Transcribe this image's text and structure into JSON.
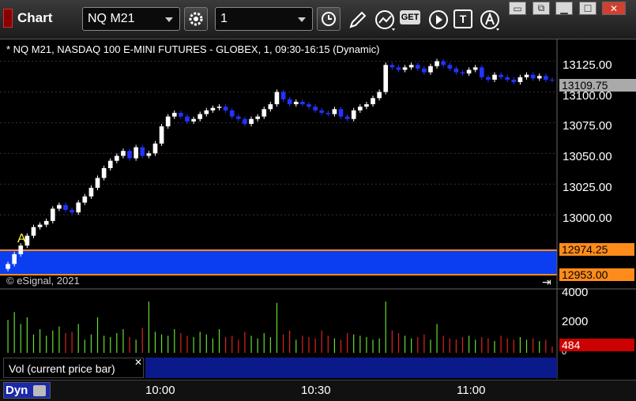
{
  "toolbar": {
    "app_title": "Chart",
    "symbol": "NQ M21",
    "interval": "1",
    "icons": [
      "settings-gear-icon",
      "clock-icon",
      "pencil-icon",
      "study-icon",
      "get-icon",
      "play-icon",
      "text-icon",
      "alert-icon"
    ],
    "get_label": "GET",
    "text_label": "T",
    "window_buttons": [
      "restore",
      "maximize",
      "minimize",
      "close"
    ]
  },
  "chart": {
    "header": "* NQ M21, NASDAQ 100 E-MINI FUTURES - GLOBEX, 1, 09:30-16:15 (Dynamic)",
    "copyright": "© eSignal, 2021",
    "marker_label": "A",
    "price_ticks": [
      "13125.00",
      "13100.00",
      "13075.00",
      "13050.00",
      "13025.00",
      "13000.00"
    ],
    "last_price": "13109.75",
    "range_high": "12974.25",
    "range_low": "12953.00",
    "volume_ticks": [
      "4000",
      "2000",
      "0"
    ],
    "last_volume": "484",
    "volume_label": "Vol (current price bar)",
    "time_ticks": [
      "10:00",
      "10:30",
      "11:00"
    ],
    "status_mode": "Dyn",
    "colors": {
      "up": "#ffffff",
      "down": "#2233ff",
      "band": "#0b3ef0",
      "band_border": "#ff8c1a",
      "vol_up": "#66dd33",
      "vol_down": "#dd2222",
      "last_price_bg": "#aaaaaa",
      "range_bg": "#ff8c1a",
      "vol_tag_bg": "#cc0000"
    }
  },
  "chart_data": {
    "type": "candlestick",
    "ylim": [
      12950,
      13135
    ],
    "x_range": [
      "09:30",
      "11:24"
    ],
    "closes": [
      12960,
      12968,
      12975,
      12983,
      12990,
      12992,
      12995,
      13005,
      13008,
      13004,
      13002,
      13010,
      13015,
      13022,
      13030,
      13038,
      13044,
      13048,
      13052,
      13046,
      13055,
      13048,
      13050,
      13058,
      13072,
      13080,
      13083,
      13080,
      13076,
      13078,
      13082,
      13085,
      13087,
      13088,
      13085,
      13080,
      13078,
      13074,
      13078,
      13080,
      13086,
      13090,
      13100,
      13094,
      13090,
      13092,
      13090,
      13088,
      13085,
      13083,
      13082,
      13086,
      13080,
      13078,
      13085,
      13088,
      13090,
      13095,
      13100,
      13122,
      13120,
      13118,
      13120,
      13122,
      13119,
      13116,
      13121,
      13125,
      13122,
      13119,
      13116,
      13115,
      13118,
      13120,
      13112,
      13110,
      13114,
      13112,
      13110,
      13108,
      13112,
      13114,
      13111,
      13113,
      13110,
      13109.75
    ],
    "volume_ylim": [
      0,
      4500
    ],
    "volumes": [
      2500,
      3100,
      2200,
      2700,
      1400,
      1800,
      1300,
      1700,
      2000,
      1500,
      1600,
      2200,
      1000,
      1400,
      2700,
      1300,
      1200,
      1500,
      1800,
      1200,
      1000,
      1900,
      3900,
      1600,
      1400,
      1300,
      1800,
      1500,
      1300,
      1200,
      1600,
      1400,
      1100,
      1800,
      1200,
      1300,
      1000,
      1600,
      1300,
      1100,
      1500,
      1200,
      3800,
      1400,
      1700,
      1000,
      1300,
      1200,
      1100,
      1700,
      1300,
      1100,
      1000,
      1500,
      1400,
      1300,
      1200,
      1000,
      1100,
      3900,
      1700,
      1500,
      1300,
      1100,
      1200,
      1400,
      1000,
      2200,
      1300,
      1100,
      1000,
      1200,
      1300,
      1000,
      1200,
      1100,
      900,
      1300,
      1100,
      1000,
      1200,
      1000,
      1100,
      900,
      1000,
      484
    ]
  }
}
